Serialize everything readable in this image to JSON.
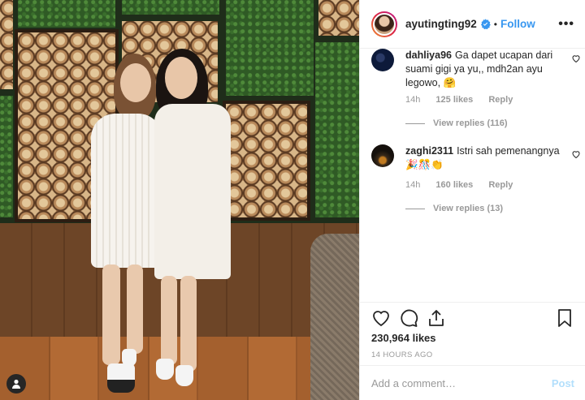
{
  "post": {
    "username": "ayutingting92",
    "dot": "•",
    "follow_label": "Follow",
    "more_icon": "more-horizontal-icon",
    "verified_color": "#3897f0"
  },
  "comments": [
    {
      "username": "dahliya96",
      "text": "Ga dapet ucapan dari suami gigi ya yu,, mdh2an ayu legowo, 🤗",
      "time": "14h",
      "likes": "125 likes",
      "reply": "Reply",
      "view_replies": "View replies (116)"
    },
    {
      "username": "zaghi2311",
      "text": "Istri sah pemenangnya 🎉🎊👏",
      "time": "14h",
      "likes": "160 likes",
      "reply": "Reply",
      "view_replies": "View replies (13)"
    }
  ],
  "actions": {
    "likes": "230,964 likes",
    "timestamp": "14 HOURS AGO"
  },
  "composer": {
    "placeholder": "Add a comment…",
    "post_label": "Post"
  },
  "colors": {
    "accent": "#3897f0",
    "post_disabled": "#b2dffc",
    "muted": "#999999"
  }
}
